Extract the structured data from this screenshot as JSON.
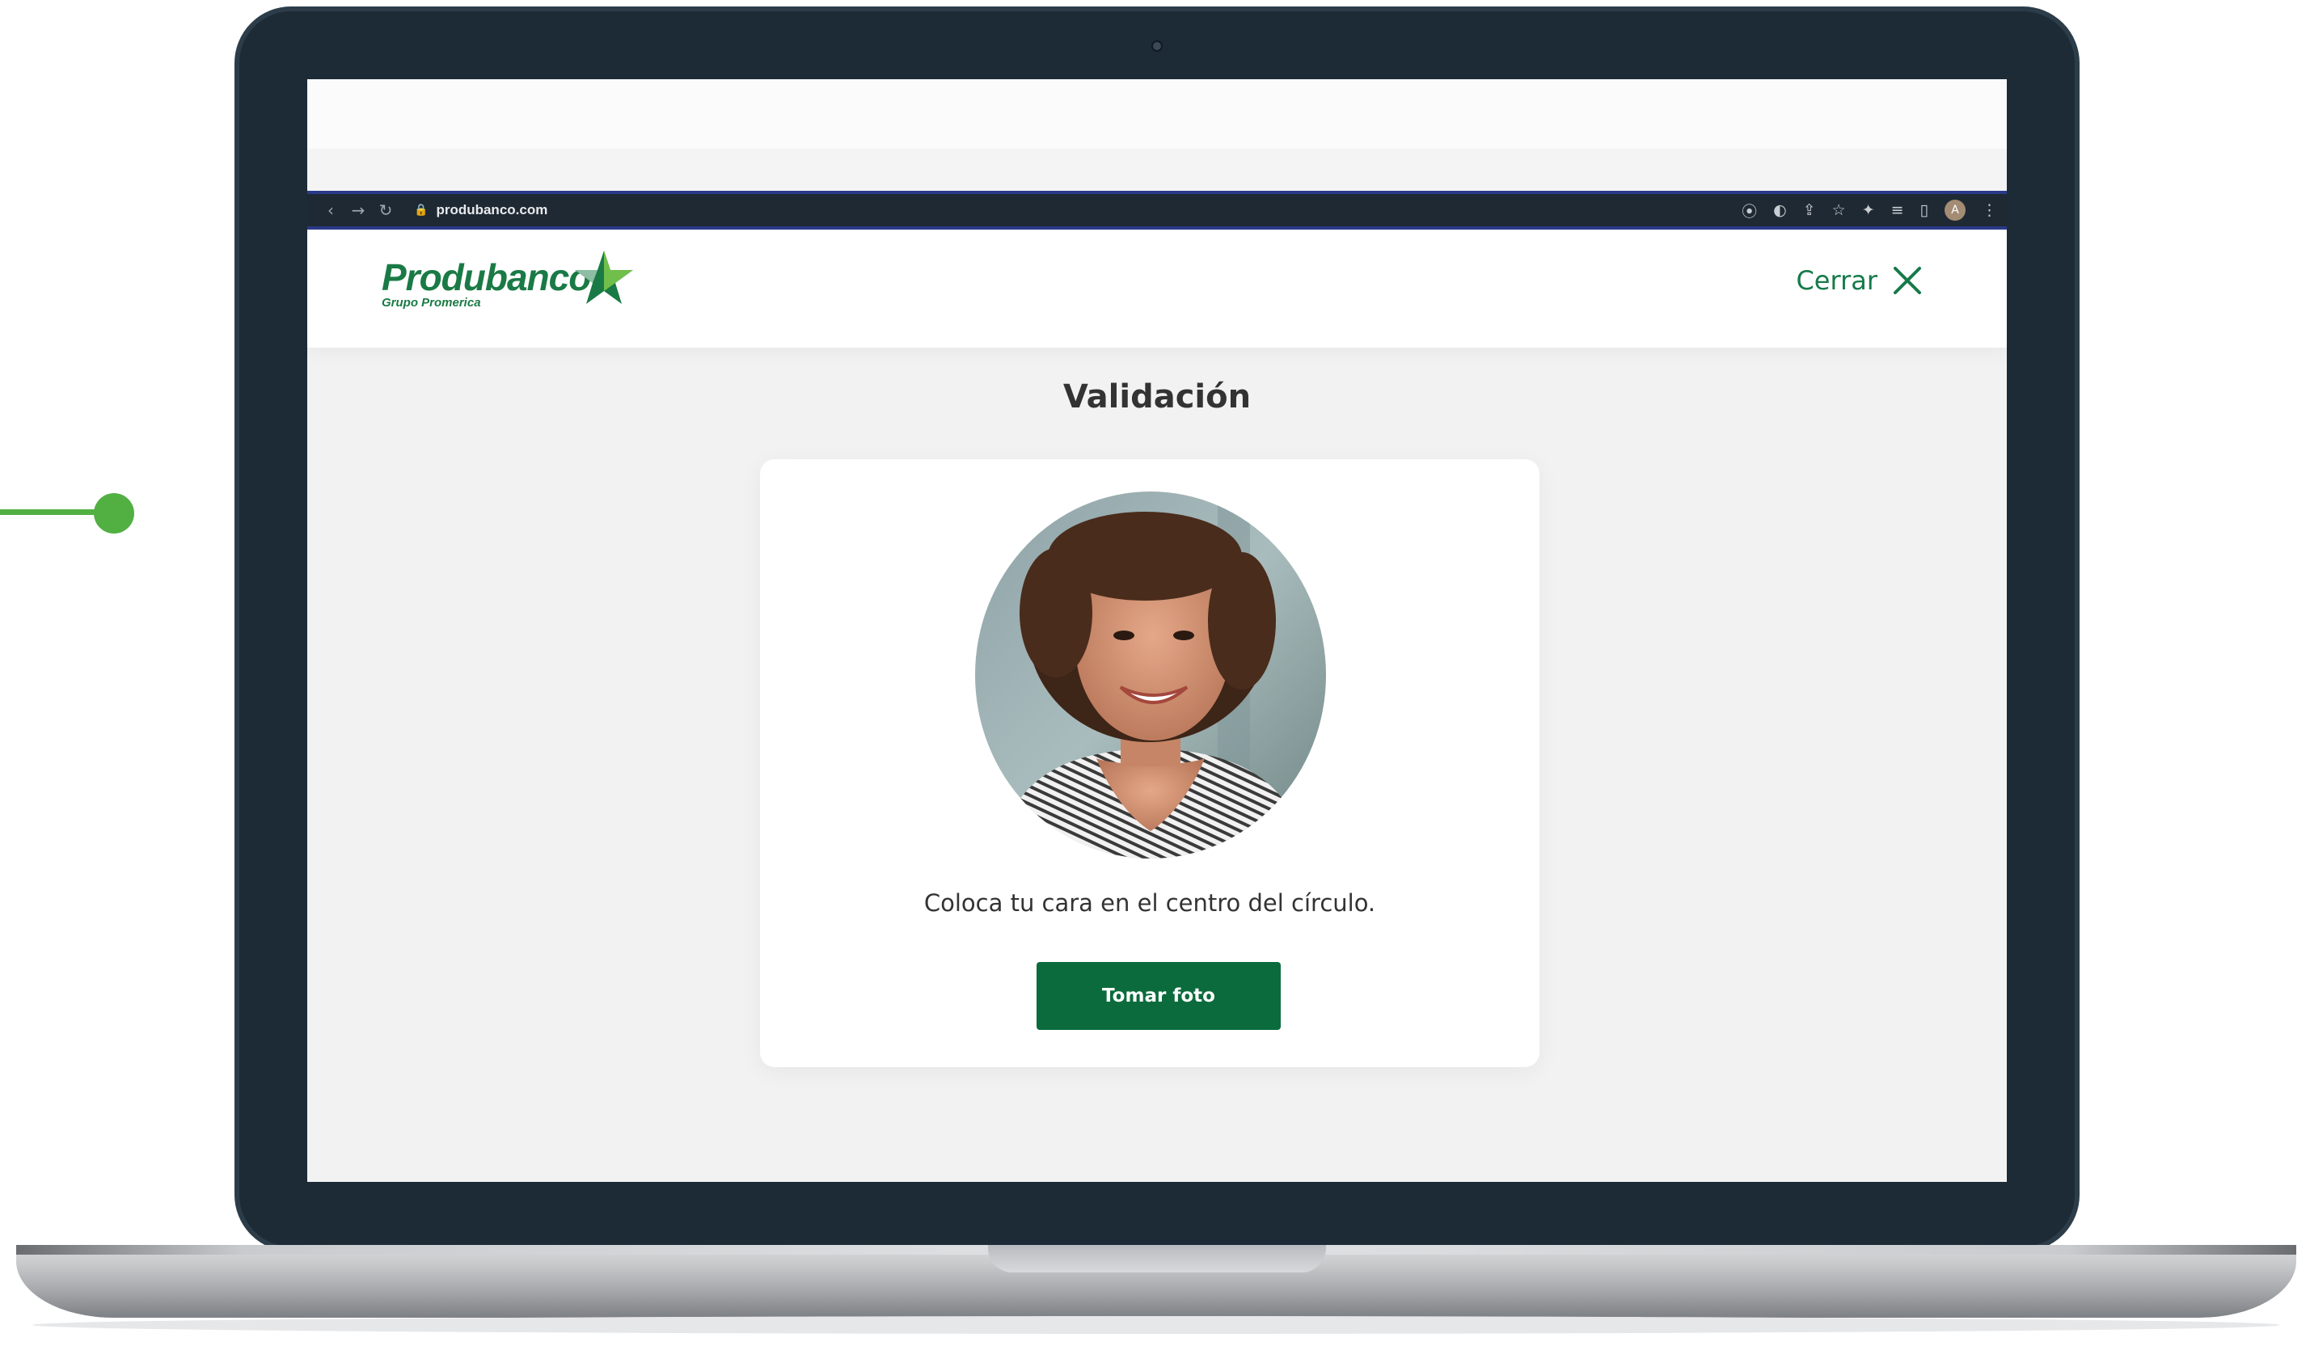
{
  "browser": {
    "url": "produbanco.com",
    "nav": {
      "back": "‹",
      "forward": "→",
      "reload": "↻"
    },
    "lock_icon": "🔒",
    "extensions": [
      "⦿",
      "◐",
      "⇪",
      "☆",
      "✦",
      "≡",
      "▯",
      "⋮"
    ],
    "avatar_initial": "A"
  },
  "header": {
    "brand": "Produbanco",
    "brand_sub": "Grupo Promerica",
    "close_label": "Cerrar"
  },
  "main": {
    "title": "Validación",
    "instruction": "Coloca tu cara en el centro del círculo.",
    "button_label": "Tomar foto"
  },
  "colors": {
    "brand_green": "#1a7a45",
    "button_green": "#0b6b3c",
    "accent_dot": "#52b043",
    "laptop_frame": "#1c2b36"
  }
}
